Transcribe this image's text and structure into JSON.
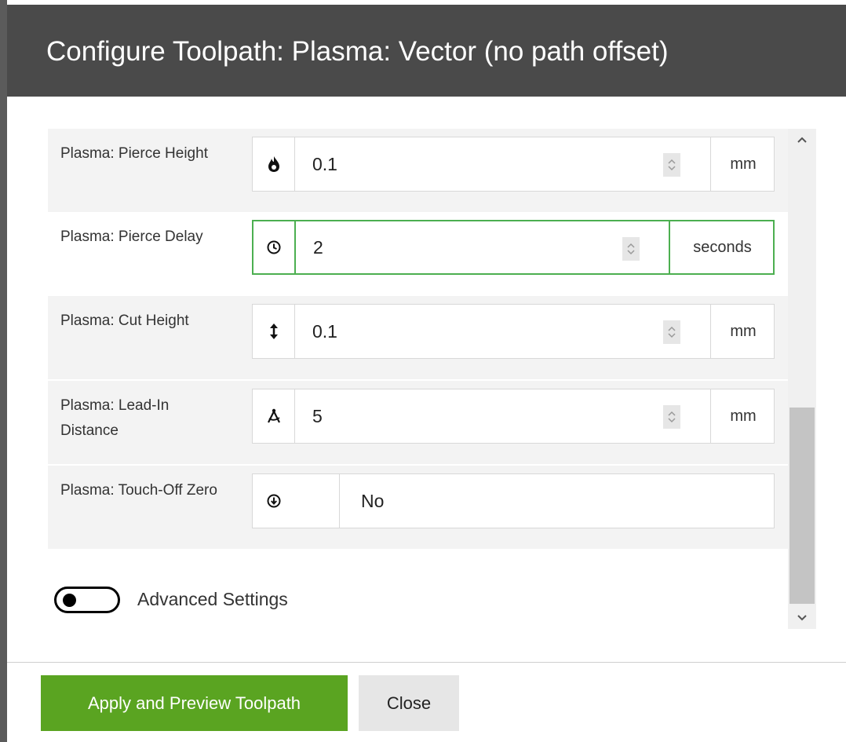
{
  "dialog": {
    "title": "Configure Toolpath: Plasma: Vector (no path offset)"
  },
  "fields": [
    {
      "label": "Plasma: Pierce Height",
      "icon": "flame-icon",
      "value": "0.1",
      "unit": "mm"
    },
    {
      "label": "Plasma: Pierce Delay",
      "icon": "clock-icon",
      "value": "2",
      "unit": "seconds"
    },
    {
      "label": "Plasma: Cut Height",
      "icon": "vertical-arrows-icon",
      "value": "0.1",
      "unit": "mm"
    },
    {
      "label": "Plasma: Lead-In Distance",
      "icon": "compass-icon",
      "value": "5",
      "unit": "mm"
    },
    {
      "label": "Plasma: Touch-Off Zero",
      "icon": "circle-down-arrow-icon",
      "value": "No"
    }
  ],
  "advanced": {
    "label": "Advanced Settings",
    "enabled": false
  },
  "footer": {
    "apply_label": "Apply and Preview Toolpath",
    "close_label": "Close"
  },
  "colors": {
    "header_bg": "#4a4a4a",
    "apply_bg": "#5aa421",
    "focus_border": "#4caf50"
  }
}
